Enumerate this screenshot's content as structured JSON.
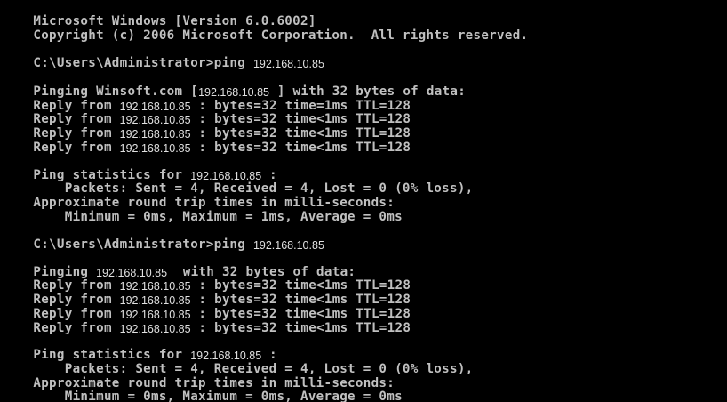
{
  "header": {
    "version": "Microsoft Windows [Version 6.0.6002]",
    "copyright": "Copyright (c) 2006 Microsoft Corporation.  All rights reserved."
  },
  "blocks": [
    {
      "prompt": "C:\\Users\\Administrator>ping ",
      "target_ip": "192.168.10.85",
      "pinging_prefix": "Pinging Winsoft.com [",
      "pinging_ip": "192.168.10.85",
      "pinging_suffix": " ] with 32 bytes of data:",
      "replies": [
        {
          "prefix": "Reply from ",
          "ip": "192.168.10.85",
          "suffix": " : bytes=32 time=1ms TTL=128"
        },
        {
          "prefix": "Reply from ",
          "ip": "192.168.10.85",
          "suffix": " : bytes=32 time<1ms TTL=128"
        },
        {
          "prefix": "Reply from ",
          "ip": "192.168.10.85",
          "suffix": " : bytes=32 time<1ms TTL=128"
        },
        {
          "prefix": "Reply from ",
          "ip": "192.168.10.85",
          "suffix": " : bytes=32 time<1ms TTL=128"
        }
      ],
      "stats_prefix": "Ping statistics for ",
      "stats_ip": "192.168.10.85",
      "stats_suffix": " :",
      "packets": "    Packets: Sent = 4, Received = 4, Lost = 0 (0% loss),",
      "approx": "Approximate round trip times in milli-seconds:",
      "minmax": "    Minimum = 0ms, Maximum = 1ms, Average = 0ms"
    },
    {
      "prompt": "C:\\Users\\Administrator>ping ",
      "target_ip": "192.168.10.85",
      "pinging_prefix": "Pinging ",
      "pinging_ip": "192.168.10.85",
      "pinging_suffix": "  with 32 bytes of data:",
      "replies": [
        {
          "prefix": "Reply from ",
          "ip": "192.168.10.85",
          "suffix": " : bytes=32 time<1ms TTL=128"
        },
        {
          "prefix": "Reply from ",
          "ip": "192.168.10.85",
          "suffix": " : bytes=32 time<1ms TTL=128"
        },
        {
          "prefix": "Reply from ",
          "ip": "192.168.10.85",
          "suffix": " : bytes=32 time<1ms TTL=128"
        },
        {
          "prefix": "Reply from ",
          "ip": "192.168.10.85",
          "suffix": " : bytes=32 time<1ms TTL=128"
        }
      ],
      "stats_prefix": "Ping statistics for ",
      "stats_ip": "192.168.10.85",
      "stats_suffix": " :",
      "packets": "    Packets: Sent = 4, Received = 4, Lost = 0 (0% loss),",
      "approx": "Approximate round trip times in milli-seconds:",
      "minmax": "    Minimum = 0ms, Maximum = 0ms, Average = 0ms"
    }
  ],
  "colors": {
    "background": "#000000",
    "foreground": "#c0c0c0"
  }
}
